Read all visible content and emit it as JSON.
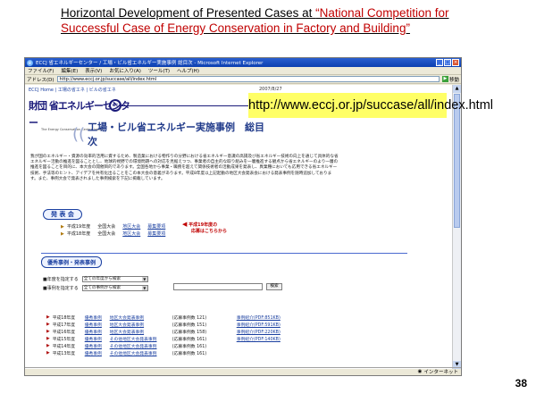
{
  "slide": {
    "title_prefix": "Horizontal Development of Presented Cases at ",
    "title_red": "“National Competition for Successful Case of Energy Conservation in Factory and Building”",
    "page_number": "38"
  },
  "browser": {
    "window_title": "ECCJ 省エネルギーセンター / 工場・ビル省エネルギー実施事例 総目次 - Microsoft Internet Explorer",
    "menu": [
      "ファイル(F)",
      "編集(E)",
      "表示(V)",
      "お気に入り(A)",
      "ツール(T)",
      "ヘルプ(H)"
    ],
    "address_label": "アドレス(D)",
    "address_value": "http://www.eccj.or.jp/succase/all/index.html",
    "go_label": "移動",
    "status_left": "",
    "status_right": "インターネット"
  },
  "page": {
    "breadcrumb": "ECCJ Home | 工場の省エネ | ビルの省エネ",
    "date": "2007/8/27",
    "logo_text": "財団 省エネルギーセンター",
    "logo_sub": "The Energy Conservation Center, Japan",
    "logo_badge": "ec",
    "big_title": "工場・ビル省エネルギー実施事例　総目次",
    "blurb": "我が国のエネルギー・資源の効率的活用に資するため、製造業における物作りの分野における省エネルギー意識の高揚及び省エネルギー技術の向上を通じて具体的な省エネルギー活動の推進を図ることとし、地球的視野での環境問題への対応を見据えつつ、事業者の自主的な取り組みを一層推進する観点から省エネルギーのより一層の推進を図ることを目的に、本大会の開催目的であります。全国各地から事業・職務を超えて関係技術者の活動成果を発表し、異業種においても応用できる省エネルギー技術、手法等のヒント、アイデアを共有化出ることをこの本大会の意義があります。平成8年度以上記起動の地区大会発表会における発表事例を随時追加しております。また、事例大会で発表されました事例検索を下記に掲載しています。",
    "url_callout": "http://www.eccj.or.jp/succase/all/index.html",
    "events_header": "発 表 会",
    "events": [
      {
        "year": "平成19年度",
        "kind": "全国大会",
        "link1": "地区大会",
        "link2": "募集要項"
      },
      {
        "year": "平成18年度",
        "kind": "全国大会",
        "link1": "地区大会",
        "link2": "募集要項"
      }
    ],
    "red_note_line1": "平成19年度の",
    "red_note_line2": "応募はこちらから",
    "cases_header": "優秀事例・発表事例",
    "filter_year_label": "■年度を指定する",
    "filter_year_value": "全ての年度から検索",
    "filter_case_label": "■事例を指定する",
    "filter_case_value": "全ての事例から検索",
    "search_button": "検索",
    "cases": [
      {
        "year": "平成18年度",
        "l1": "優秀事例",
        "l2": "地区大会発表事例",
        "count": "(応募事例数 121)",
        "l3": "事例紹介(PDF:851KB)"
      },
      {
        "year": "平成17年度",
        "l1": "優秀事例",
        "l2": "地区大会発表事例",
        "count": "(応募事例数 151)",
        "l3": "事例紹介(PDF:591KB)"
      },
      {
        "year": "平成16年度",
        "l1": "優秀事例",
        "l2": "地区大会発表事例",
        "count": "(応募事例数 158)",
        "l3": "事例紹介(PDF:220KB)"
      },
      {
        "year": "平成15年度",
        "l1": "優秀事例",
        "l2": "その他地区大会発表事例",
        "count": "(応募事例数 161)",
        "l3": "事例紹介(PDF:140KB)"
      },
      {
        "year": "平成14年度",
        "l1": "優秀事例",
        "l2": "その他地区大会発表事例",
        "count": "(応募事例数 161)",
        "l3": ""
      },
      {
        "year": "平成13年度",
        "l1": "優秀事例",
        "l2": "その他地区大会発表事例",
        "count": "(応募事例数 161)",
        "l3": ""
      }
    ]
  }
}
